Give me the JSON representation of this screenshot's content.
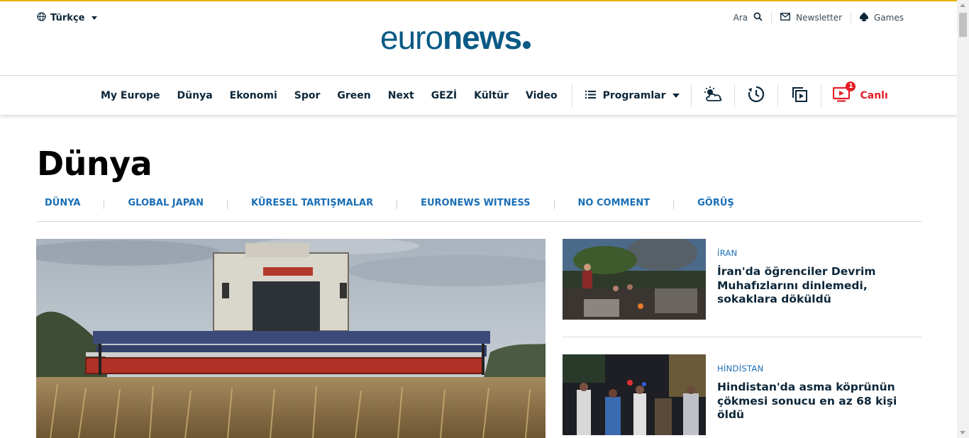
{
  "header": {
    "language": "Türkçe",
    "logo": {
      "light": "euro",
      "bold": "news"
    },
    "search_label": "Ara",
    "newsletter_label": "Newsletter",
    "games_label": "Games"
  },
  "nav": {
    "items": [
      "My Europe",
      "Dünya",
      "Ekonomi",
      "Spor",
      "Green",
      "Next",
      "GEZİ",
      "Kültür",
      "Video"
    ],
    "programs_label": "Programlar",
    "live_label": "Canlı",
    "live_badge": "1"
  },
  "page": {
    "title": "Dünya",
    "subnav": [
      "DÜNYA",
      "GLOBAL JAPAN",
      "KÜRESEL TARTIŞMALAR",
      "EURONEWS WITNESS",
      "NO COMMENT",
      "GÖRÜŞ"
    ]
  },
  "stories": [
    {
      "category": "İRAN",
      "headline": "İran'da öğrenciler Devrim Muhafızlarını dinlemedi, sokaklara döküldü"
    },
    {
      "category": "HİNDİSTAN",
      "headline": "Hindistan'da asma köprünün çökmesi sonucu en az 68 kişi öldü"
    }
  ],
  "colors": {
    "brand": "#0a5a85",
    "link": "#1a6fb7",
    "live": "#e41e26",
    "accent_line": "#e3b500"
  }
}
